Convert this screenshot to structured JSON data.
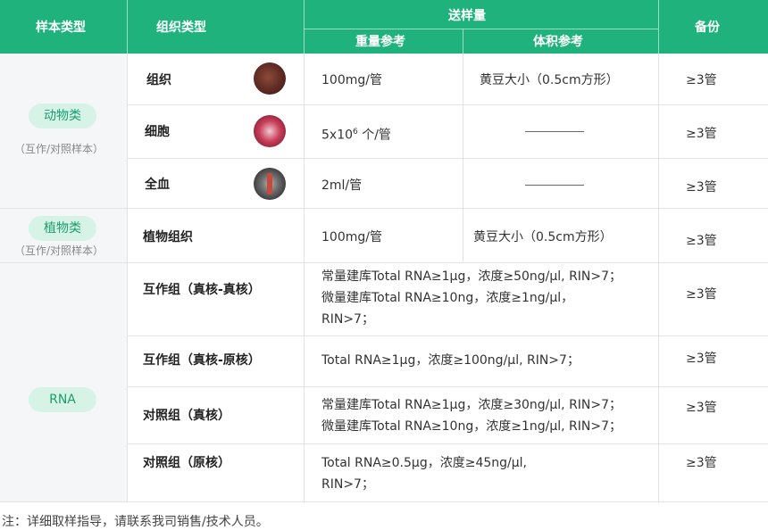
{
  "header": {
    "sample_type": "样本类型",
    "tissue_type": "组织类型",
    "send_amount": "送样量",
    "weight_ref": "重量参考",
    "volume_ref": "体积参考",
    "backup": "备份"
  },
  "groups": {
    "animal": {
      "label": "动物类",
      "note": "（互作/对照样本）"
    },
    "plant": {
      "label": "植物类",
      "note": "（互作/对照样本）"
    },
    "rna": {
      "label": "RNA"
    }
  },
  "rows": [
    {
      "tissue": "组织",
      "weight": "100mg/管",
      "volume": "黄豆大小（0.5cm方形）",
      "backup": "≥3管",
      "thumb": "tissue-photo"
    },
    {
      "tissue": "细胞",
      "weight_base": "5x10",
      "weight_exp": "6",
      "weight_unit": " 个/管",
      "volume": "———————",
      "backup": "≥3管",
      "thumb": "cell-photo"
    },
    {
      "tissue": "全血",
      "weight": "2ml/管",
      "volume": "———————",
      "backup": "≥3管",
      "thumb": "blood-photo"
    },
    {
      "tissue": "植物组织",
      "weight": "100mg/管",
      "volume": "黄豆大小（0.5cm方形）",
      "backup": "≥3管"
    },
    {
      "tissue": "互作组（真核-真核）",
      "req": "常量建库Total RNA≥1μg，浓度≥50ng/μl, RIN>7；\n微量建库Total RNA≥10ng，浓度≥1ng/μl，\nRIN>7；",
      "backup": "≥3管"
    },
    {
      "tissue": "互作组（真核-原核）",
      "req": "Total RNA≥1μg，浓度≥100ng/μl, RIN>7；",
      "backup": "≥3管"
    },
    {
      "tissue": "对照组（真核）",
      "req": "常量建库Total RNA≥1μg，浓度≥30ng/μl, RIN>7；\n微量建库Total RNA≥10ng，浓度≥1ng/μl, RIN>7；",
      "backup": "≥3管"
    },
    {
      "tissue": "对照组（原核）",
      "req": "Total RNA≥0.5μg，浓度≥45ng/μl,\nRIN>7；",
      "backup": "≥3管"
    }
  ],
  "footnote": "注：详细取样指导，请联系我司销售/技术人员。",
  "colors": {
    "header_bg": "#1fb27d",
    "pill_bg": "#d7f3e8",
    "pill_text": "#1a9e6e",
    "stripe": "#f5f6f8"
  }
}
